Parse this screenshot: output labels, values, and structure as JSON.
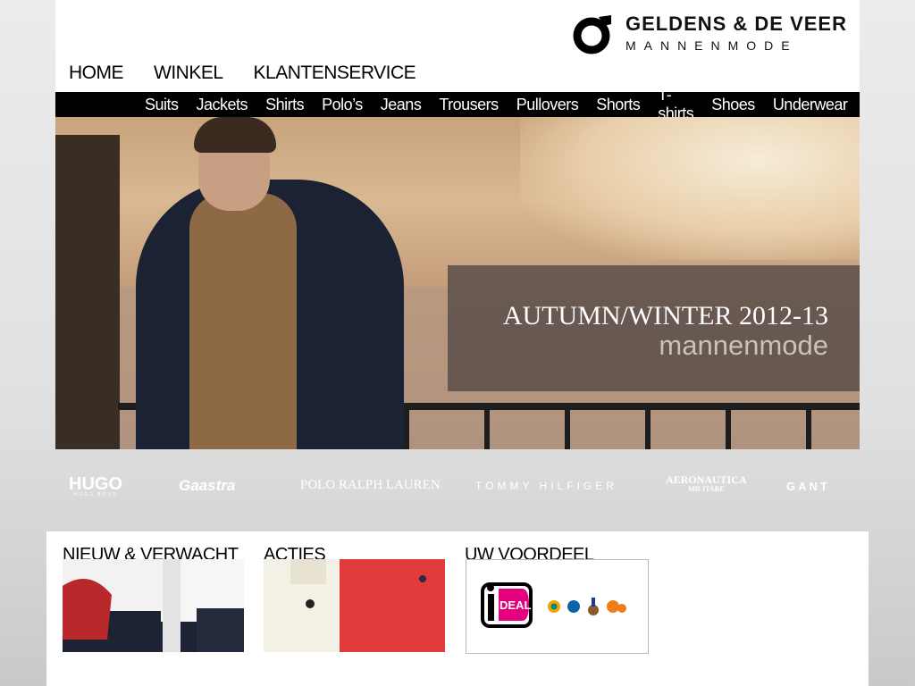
{
  "logo": {
    "name": "GELDENS & DE VEER",
    "subtitle": "MANNENMODE"
  },
  "main_nav": [
    "HOME",
    "WINKEL",
    "KLANTENSERVICE"
  ],
  "categories": [
    "Suits",
    "Jackets",
    "Shirts",
    "Polo’s",
    "Jeans",
    "Trousers",
    "Pullovers",
    "Shorts",
    "T-shirts",
    "Shoes",
    "Underwear"
  ],
  "hero": {
    "title": "AUTUMN/WINTER 2012-13",
    "subtitle": "mannenmode"
  },
  "brands": [
    "HUGO",
    "HUGO BOSS",
    "Gaastra",
    "POLO RALPH LAUREN",
    "TOMMY HILFIGER",
    "AERONAUTICA",
    "MILITARE",
    "GANT"
  ],
  "sections": {
    "new": "NIEUW & VERWACHT",
    "acties": "ACTIES",
    "voordeel": "UW VOORDEEL"
  },
  "payment": {
    "ideal": "DEAL"
  },
  "colors": {
    "brand": "#000000",
    "caption_bg": "#5c504a",
    "body_bg": "#e0e0e0"
  }
}
